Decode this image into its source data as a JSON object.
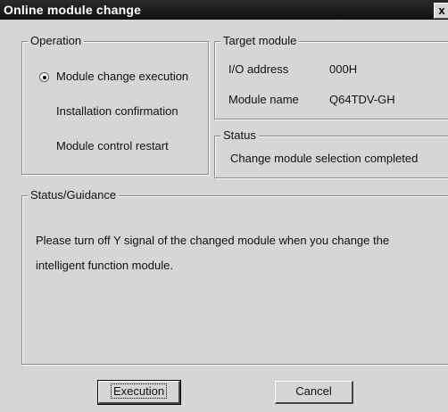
{
  "window": {
    "title": "Online module change",
    "close_label": "x"
  },
  "operation": {
    "legend": "Operation",
    "options": [
      {
        "label": "Module change execution",
        "selected": true
      },
      {
        "label": "Installation confirmation",
        "selected": false
      },
      {
        "label": "Module control restart",
        "selected": false
      }
    ]
  },
  "target_module": {
    "legend": "Target module",
    "io_address_label": "I/O address",
    "io_address_value": "000H",
    "module_name_label": "Module name",
    "module_name_value": "Q64TDV-GH"
  },
  "status": {
    "legend": "Status",
    "text": "Change module selection completed"
  },
  "guidance": {
    "legend": "Status/Guidance",
    "line1": "Please turn off Y signal of the changed module when you change the",
    "line2": "intelligent function module."
  },
  "buttons": {
    "execute_label": "Execution",
    "cancel_label": "Cancel"
  }
}
